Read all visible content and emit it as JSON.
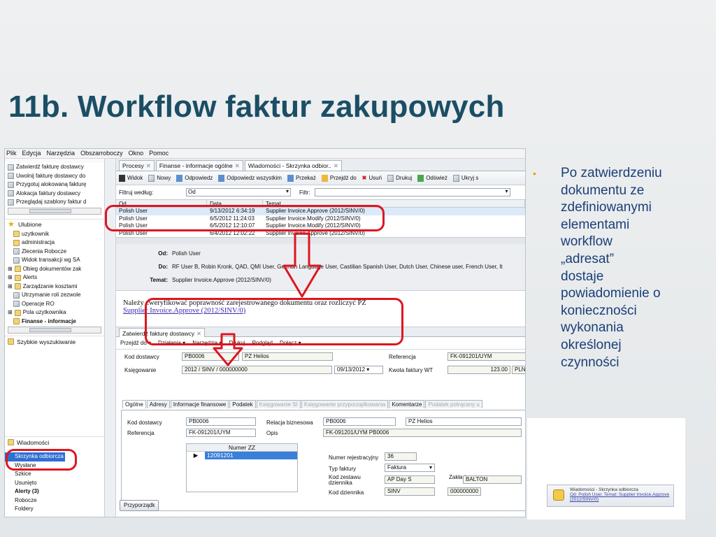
{
  "slide": {
    "title": "11b. Workflow faktur zakupowych",
    "bullet": "Po zatwierdzeniu\ndokumentu ze\nzdefiniowanymi\nelementami\nworkflow\n„adresat”\ndostaje\npowiadomienie o\nkonieczności\nwykonania\nokreślonej\nczynności"
  },
  "menu": [
    "Plik",
    "Edycja",
    "Narzędzia",
    "Obszarroboczy",
    "Okno",
    "Pomoc"
  ],
  "left": {
    "process_items": [
      "Zatwierdź fakturę dostawcy",
      "Uwolnij fakturę dostawcy do",
      "Przygotuj alokowaną fakturę",
      "Alokacja faktury dostawcy",
      "Przeglądaj szablony faktur d"
    ],
    "favorites_label": "Ulubione",
    "favorites": [
      "uzytkownik",
      "administracja",
      "Zlecenia Robocze",
      "Widok transakcji wg SA",
      "Obieg dokumentów zak",
      "Alerts",
      "Zarządzanie kosztami",
      "Utrzymanie roli zezwole",
      "Operacje RO",
      "Pola uzytkownika",
      "Finanse - informacje"
    ],
    "quick_search": "Szybkie wyszukiwanie",
    "messages_label": "Wiadomości",
    "message_folders": [
      "Skrzynka odbiorcza",
      "Wysłane",
      "Szkice",
      "Usunięto",
      "Alerty (3)",
      "Robocze",
      "Foldery"
    ]
  },
  "tabs": [
    "Procesy",
    "Finanse - informacje ogólne",
    "Wiadomości - Skrzynka odbior.."
  ],
  "toolbar": [
    "Widok",
    "Nowy",
    "Odpowiedz",
    "Odpowiedz wszystkim",
    "Przekaż",
    "Przejdź do",
    "Usuń",
    "Drukuj",
    "Odśwież",
    "Ukryj s"
  ],
  "filter": {
    "label": "Filtruj według:",
    "value": "Od",
    "filter_label": "Filtr:"
  },
  "inbox": {
    "columns": [
      "Od",
      "Data",
      "Temat"
    ],
    "rows": [
      [
        "Polish User",
        "9/13/2012 6:34:19",
        "Supplier Invoice.Approve (2012/SINV/0)"
      ],
      [
        "Polish User",
        "6/5/2012 11:24:03",
        "Supplier Invoice.Modify (2012/SINV/0)"
      ],
      [
        "Polish User",
        "6/5/2012 12:10:07",
        "Supplier Invoice.Modify (2012/SINV/0)"
      ],
      [
        "Polish User",
        "6/4/2012 12:02:22",
        "Supplier Invoice.Approve (2012/SINV/0)"
      ]
    ]
  },
  "message": {
    "from_label": "Od:",
    "from": "Polish User",
    "to_label": "Do:",
    "to": "RF User B, Robin Kronk, QAD, QMI User, German Language User, Castilian Spanish User, Dutch User, Chinese user, French User, It",
    "subject_label": "Temat:",
    "subject": "Supplier Invoice.Approve (2012/SINV/0)",
    "body": "Należy zweryfikować poprawność zarejestrowanego dokumentu oraz rozliczyć PZ",
    "link": "Supplier Invoice.Approve (2012/SINV/0)"
  },
  "form": {
    "tab": "Zatwierdź fakturę dostawcy",
    "toolbar": [
      "Przejdź do",
      "Działania",
      "Narzędzia",
      "Drukuj",
      "Podgląd",
      "Dołącz"
    ],
    "kod_dostawcy_label": "Kod dostawcy",
    "kod_dostawcy": "PB0006",
    "supplier_name": "PZ Helios",
    "referencja_label": "Referencja",
    "referencja": "FK-091201/UYM",
    "ksiegowanie_label": "Księgowanie",
    "ksiegowanie": "2012 / SINV / 000000000",
    "date": "09/13/2012",
    "kwota_label": "Kwota faktury WT",
    "kwota": "123.00",
    "currency": "PLN",
    "subtabs": [
      "Ogólne",
      "Adresy",
      "Informacje finansowe",
      "Podatek",
      "Księgowanie SI",
      "Księgowanie przyporządkowania",
      "Komentarze",
      "Podatek potrącany u"
    ],
    "g_kod_label": "Kod dostawcy",
    "g_kod": "PB0006",
    "g_ref_label": "Referencja",
    "g_ref": "FK-091201/UYM",
    "relacja_label": "Relacja biznesowa",
    "relacja": "PB0006",
    "relacja_name": "PZ Helios",
    "opis_label": "Opis",
    "opis": "FK-091201/UYM PB0006",
    "numer_zz_label": "Numer ZZ",
    "numer_zz": "12091201",
    "nr_rej_label": "Numer rejestracyjny",
    "nr_rej": "36",
    "typ_label": "Typ faktury",
    "typ": "Faktura",
    "kod_zestawu_label": "Kod zestawu dziennika",
    "kod_zestawu": "AP Day S",
    "zak_label": "Zakład",
    "zak": "BALTON",
    "kod_dziennika_label": "Kod dziennika",
    "kod_dziennika": "SINV",
    "kod_dziennika_num": "000000000",
    "przyporzadk": "Przyporządk"
  },
  "notification": {
    "title": "Wiadomości - Skrzynka odbiorcza",
    "link": "Od: Polish User, Temat: Supplier Invoice.Approve (2012/SINV/0)"
  },
  "colors": {
    "title": "#1b4e65",
    "bullet_text": "#1a3f78",
    "bullet_dot": "#f19a1a",
    "annotation_red": "#dd1620"
  }
}
